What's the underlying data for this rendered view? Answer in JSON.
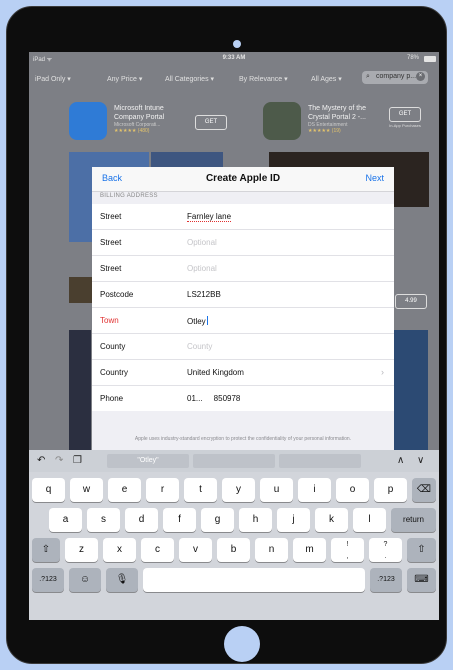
{
  "status_bar": {
    "left": "iPad ᯤ",
    "time": "9:33 AM",
    "battery": "78%"
  },
  "filters": {
    "items": [
      "iPad Only ▾",
      "Any Price ▾",
      "All Categories ▾",
      "By Relevance ▾",
      "All Ages ▾"
    ],
    "search_value": "company p..."
  },
  "background_apps": [
    {
      "title": "Microsoft Intune Company Portal",
      "subtitle": "Microsoft Corporati...",
      "rating": "★★★★★ (480)",
      "action": "GET"
    },
    {
      "title": "The Mystery of the Crystal Portal 2 -...",
      "subtitle": "DS Entertainment",
      "rating": "★★★★★ (19)",
      "action": "GET",
      "note": "In-App Purchases"
    }
  ],
  "background_side_button": "4.99",
  "modal": {
    "back_label": "Back",
    "title": "Create Apple ID",
    "next_label": "Next",
    "section_label": "BILLING ADDRESS",
    "rows": [
      {
        "label": "Street",
        "value": "Farnley lane",
        "placeholder": ""
      },
      {
        "label": "Street",
        "value": "",
        "placeholder": "Optional"
      },
      {
        "label": "Street",
        "value": "",
        "placeholder": "Optional"
      },
      {
        "label": "Postcode",
        "value": "LS212BB",
        "placeholder": ""
      },
      {
        "label": "Town",
        "value": "Otley",
        "placeholder": ""
      },
      {
        "label": "County",
        "value": "",
        "placeholder": "County"
      },
      {
        "label": "Country",
        "value": "United Kingdom",
        "placeholder": ""
      },
      {
        "label": "Phone",
        "value": "01...     850978",
        "placeholder": ""
      }
    ],
    "privacy_text": "Apple uses industry-standard encryption to protect the confidentiality of your personal information."
  },
  "keyboard": {
    "suggestion": "\"Otley\"",
    "row1": [
      "q",
      "w",
      "e",
      "r",
      "t",
      "y",
      "u",
      "i",
      "o",
      "p"
    ],
    "row2": [
      "a",
      "s",
      "d",
      "f",
      "g",
      "h",
      "j",
      "k",
      "l"
    ],
    "row3": [
      "z",
      "x",
      "c",
      "v",
      "b",
      "n",
      "m"
    ],
    "return_label": "return",
    "numbers_label": ".?123",
    "excl_top": "!",
    "excl_bottom": ",",
    "quest_top": "?",
    "quest_bottom": "."
  }
}
